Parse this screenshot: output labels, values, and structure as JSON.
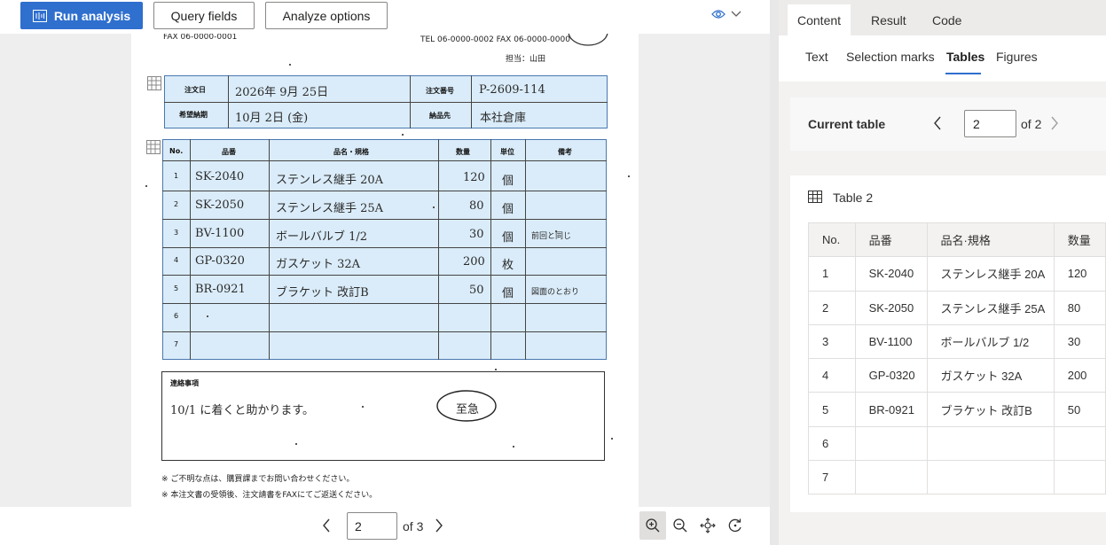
{
  "toolbar": {
    "run_label": "Run analysis",
    "query_label": "Query fields",
    "options_label": "Analyze options"
  },
  "document": {
    "fax_top": "FAX 06-0000-0001",
    "tel_fax": "TEL 06-0000-0002   FAX 06-0000-0000",
    "tantou": "担当：山田",
    "order_date_label": "注文日",
    "order_date": "2026年 9月 25日",
    "order_no_label": "注文番号",
    "order_no": "P-2609-114",
    "delivery_label": "希望納期",
    "delivery": "10月 2日 (金)",
    "dest_label": "納品先",
    "dest": "本社倉庫",
    "headers": [
      "No.",
      "品番",
      "品名・規格",
      "数量",
      "単位",
      "備考"
    ],
    "rows": [
      {
        "no": "1",
        "code": "SK-2040",
        "name": "ステンレス継手 20A",
        "qty": "120",
        "unit": "個",
        "note": ""
      },
      {
        "no": "2",
        "code": "SK-2050",
        "name": "ステンレス継手 25A",
        "qty": "80",
        "unit": "個",
        "note": ""
      },
      {
        "no": "3",
        "code": "BV-1100",
        "name": "ボールバルブ 1/2",
        "qty": "30",
        "unit": "個",
        "note": "前回と同じ"
      },
      {
        "no": "4",
        "code": "GP-0320",
        "name": "ガスケット 32A",
        "qty": "200",
        "unit": "枚",
        "note": ""
      },
      {
        "no": "5",
        "code": "BR-0921",
        "name": "ブラケット 改訂B",
        "qty": "50",
        "unit": "個",
        "note": "図面のとおり"
      },
      {
        "no": "6",
        "code": "",
        "name": "",
        "qty": "",
        "unit": "",
        "note": ""
      },
      {
        "no": "7",
        "code": "",
        "name": "",
        "qty": "",
        "unit": "",
        "note": ""
      }
    ],
    "memo_label": "連絡事項",
    "memo_text": "10/1 に着くと助かります。",
    "urgent": "至急",
    "footnote1": "※ ご不明な点は、購買課までお問い合わせください。",
    "footnote2": "※ 本注文書の受領後、注文請書をFAXにてご返送ください。"
  },
  "pager": {
    "page_value": "2",
    "of_label": "of 3"
  },
  "panel": {
    "tabs": [
      "Content",
      "Result",
      "Code"
    ],
    "active_tab": "Content",
    "subtabs": [
      "Text",
      "Selection marks",
      "Tables",
      "Figures"
    ],
    "active_subtab": "Tables",
    "current_table_label": "Current table",
    "current_table_value": "2",
    "current_table_of": "of 2",
    "table_title": "Table 2",
    "table_headers": [
      "No.",
      "品番",
      "品名·規格",
      "数量"
    ],
    "table_rows": [
      [
        "1",
        "SK-2040",
        "ステンレス継手 20A",
        "120"
      ],
      [
        "2",
        "SK-2050",
        "ステンレス継手 25A",
        "80"
      ],
      [
        "3",
        "BV-1100",
        "ボールバルブ 1/2",
        "30"
      ],
      [
        "4",
        "GP-0320",
        "ガスケット 32A",
        "200"
      ],
      [
        "5",
        "BR-0921",
        "ブラケット 改訂B",
        "50"
      ],
      [
        "6",
        "",
        "",
        ""
      ],
      [
        "7",
        "",
        "",
        ""
      ]
    ]
  },
  "colors": {
    "accent": "#2f6fce",
    "highlight": "#d6eaf8"
  }
}
